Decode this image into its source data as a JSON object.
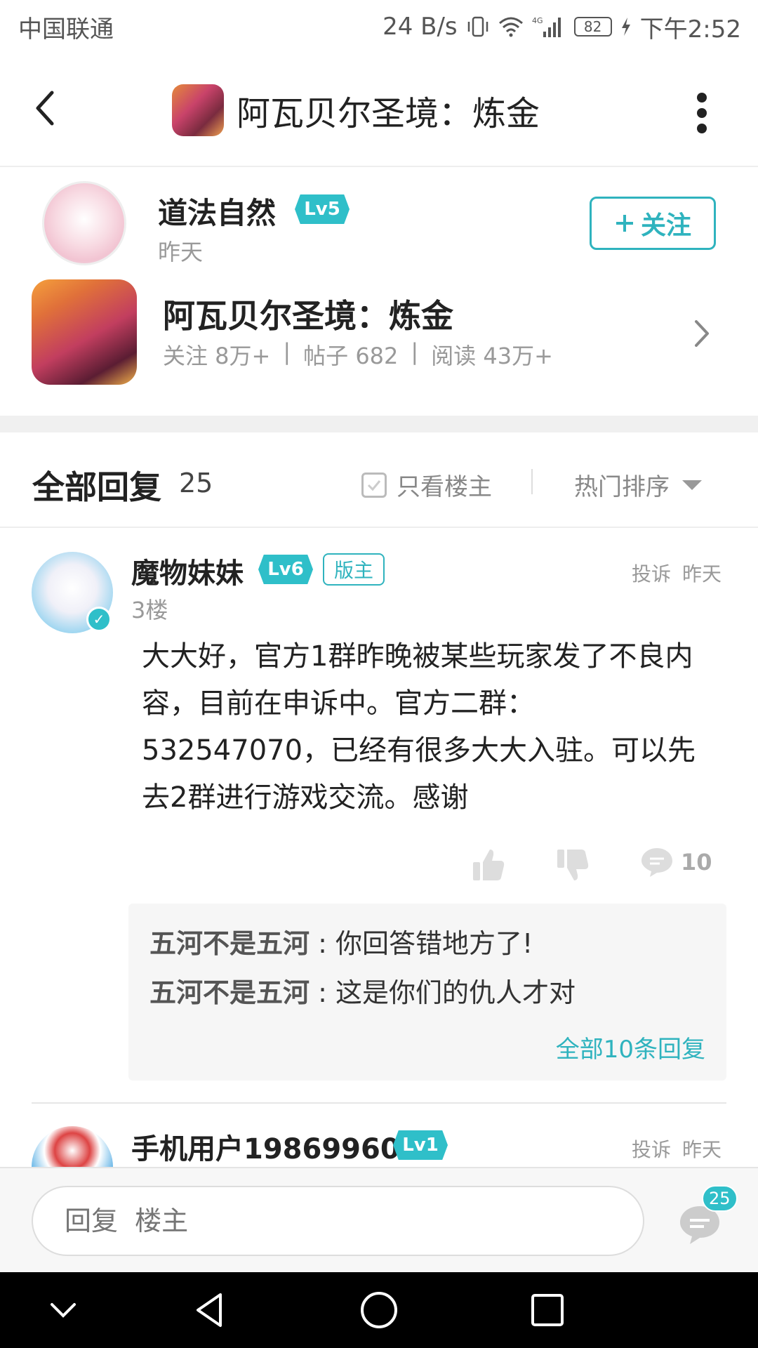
{
  "status_bar": {
    "carrier": "中国联通",
    "net_speed": "24 B/s",
    "network": "4G",
    "battery": "82",
    "time": "下午2:52"
  },
  "header": {
    "title": "阿瓦贝尔圣境：炼金"
  },
  "author": {
    "name": "道法自然",
    "level": "Lv5",
    "time": "昨天",
    "follow_label": "关注"
  },
  "game": {
    "name": "阿瓦贝尔圣境：炼金",
    "stats": [
      "关注 8万+",
      "|",
      "帖子 682",
      "|",
      "阅读 43万+"
    ]
  },
  "replies": {
    "title": "全部回复",
    "count": "25",
    "only_host": "只看楼主",
    "sort": "热门排序"
  },
  "comments": [
    {
      "user": "魔物妹妹",
      "level": "Lv6",
      "badge": "版主",
      "report": "投诉",
      "time": "昨天",
      "floor": "3楼",
      "body": "大大好，官方1群昨晚被某些玩家发了不良内容，目前在申诉中。官方二群：532547070，已经有很多大大入驻。可以先去2群进行游戏交流。感谢",
      "comment_count": "10",
      "sub_replies": [
        {
          "user": "五河不是五河",
          "sep": " : ",
          "text": "你回答错地方了!"
        },
        {
          "user": "五河不是五河",
          "sep": " : ",
          "text": "这是你们的仇人才对"
        }
      ],
      "all_replies": "全部10条回复"
    },
    {
      "user": "手机用户19869960",
      "level": "Lv1",
      "report": "投诉",
      "time": "昨天"
    }
  ],
  "bottom": {
    "placeholder": "回复  楼主",
    "badge": "25"
  },
  "colors": {
    "accent": "#2fbfc9",
    "text": "#222222",
    "muted": "#999999"
  }
}
